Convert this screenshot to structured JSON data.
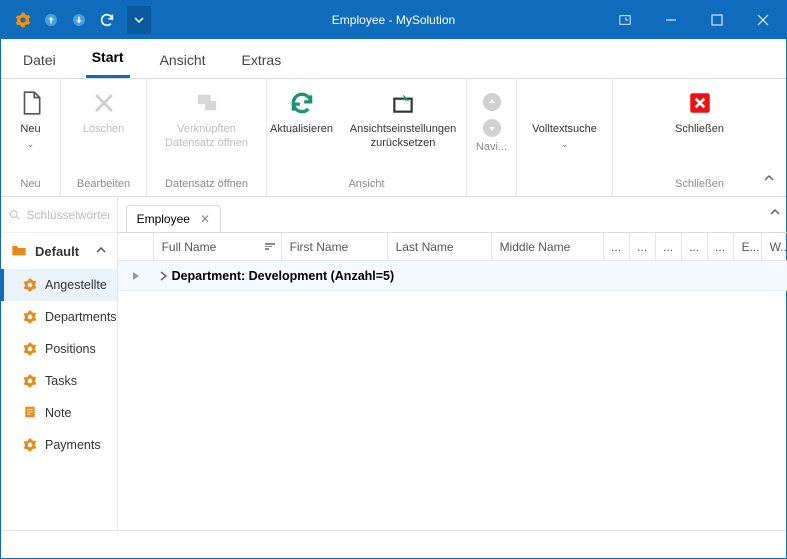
{
  "title": "Employee - MySolution",
  "menu": {
    "file": "Datei",
    "start": "Start",
    "view": "Ansicht",
    "extras": "Extras"
  },
  "ribbon": {
    "neu": {
      "label": "Neu",
      "group": "Neu"
    },
    "loeschen": {
      "label": "Löschen",
      "group": "Bearbeiten"
    },
    "verknuepft": {
      "line1": "Verknüpften",
      "line2": "Datensatz öffnen",
      "group": "Datensatz öffnen"
    },
    "aktualisieren": {
      "label": "Aktualisieren"
    },
    "reset": {
      "line1": "Ansichtseinstellungen",
      "line2": "zurücksetzen"
    },
    "ansicht_group": "Ansicht",
    "nav_group": "Navi...",
    "volltext": {
      "label": "Volltextsuche"
    },
    "schliessen": {
      "label": "Schließen",
      "group": "Schließen"
    }
  },
  "sidebar": {
    "search_placeholder": "Schlüsselwörter hier e",
    "category": "Default",
    "items": [
      {
        "label": "Angestellte"
      },
      {
        "label": "Departments"
      },
      {
        "label": "Positions"
      },
      {
        "label": "Tasks"
      },
      {
        "label": "Note"
      },
      {
        "label": "Payments"
      }
    ]
  },
  "tab": {
    "label": "Employee"
  },
  "columns": {
    "fullname": "Full Name",
    "first": "First Name",
    "last": "Last Name",
    "middle": "Middle Name",
    "dots": "...",
    "e": "E...",
    "w": "W..."
  },
  "group_row": "Department: Development (Anzahl=5)"
}
